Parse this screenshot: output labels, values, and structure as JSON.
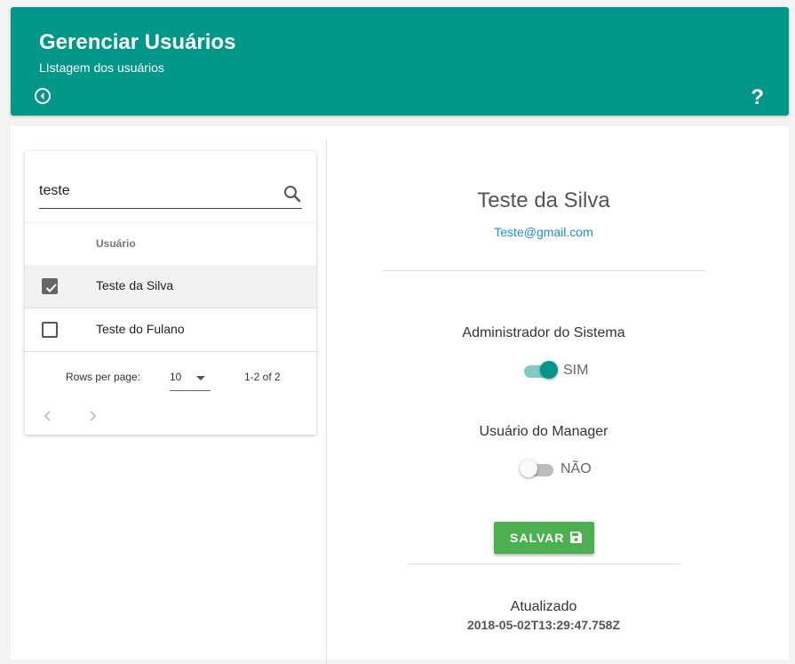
{
  "header": {
    "title": "Gerenciar Usuários",
    "subtitle": "LIstagem dos usuários",
    "help_label": "?"
  },
  "search": {
    "value": "teste"
  },
  "table": {
    "column_header": "Usuário",
    "rows": [
      {
        "name": "Teste da Silva",
        "checked": true
      },
      {
        "name": "Teste do Fulano",
        "checked": false
      }
    ],
    "rows_per_page_label": "Rows per page:",
    "rows_per_page_value": "10",
    "range": "1-2 of 2"
  },
  "detail": {
    "name": "Teste da Silva",
    "email": "Teste@gmail.com",
    "admin_label": "Administrador do Sistema",
    "admin_state": "SIM",
    "manager_label": "Usuário do Manager",
    "manager_state": "NÃO",
    "save_label": "SALVAR",
    "updated_label": "Atualizado",
    "updated_value": "2018-05-02T13:29:47.758Z"
  },
  "colors": {
    "header_bg": "#009688",
    "save_button": "#4caf50",
    "email_link": "#1e88e5"
  }
}
